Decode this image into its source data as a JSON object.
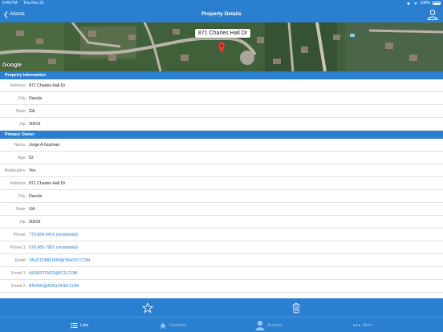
{
  "status_bar": {
    "time": "5:49 PM",
    "date": "Thu Nov 21",
    "battery": "100%"
  },
  "nav": {
    "back_label": "Atlanta",
    "title": "Property Details"
  },
  "map": {
    "callout": "871 Charles Hall Dr",
    "google_logo": "Google"
  },
  "property_info": {
    "header": "Property Information",
    "rows": [
      {
        "label": "Address:",
        "value": "871 Charles Hall Dr"
      },
      {
        "label": "City:",
        "value": "Dacula"
      },
      {
        "label": "State:",
        "value": "GA"
      },
      {
        "label": "Zip:",
        "value": "30019"
      }
    ]
  },
  "primary_owner": {
    "header": "Primary Owner",
    "rows": [
      {
        "label": "Name:",
        "value": "Jorge A Guzman"
      },
      {
        "label": "Age:",
        "value": "52"
      },
      {
        "label": "Bankruptcy:",
        "value": "Yes"
      },
      {
        "label": "Address:",
        "value": "871 Charles Hall Dr"
      },
      {
        "label": "City:",
        "value": "Dacula"
      },
      {
        "label": "State:",
        "value": "GA"
      },
      {
        "label": "Zip:",
        "value": "30019"
      },
      {
        "label": "Phone:",
        "value": "770-564-0416 (residential)"
      },
      {
        "label": "Phone 1:",
        "value": "678-985-7952 (residential)"
      },
      {
        "label": "Email:",
        "value": "TALKTOMRJAIN@YAHOO.COM"
      },
      {
        "label": "Email 1:",
        "value": "ALBERTO423@ICS.COM"
      },
      {
        "label": "Email 2:",
        "value": "BNYAG@ADELPHIA.COM"
      }
    ]
  },
  "tabs": [
    {
      "label": "Lists",
      "icon": "list-icon",
      "active": true
    },
    {
      "label": "Favorites",
      "icon": "star-icon",
      "active": false
    },
    {
      "label": "Account",
      "icon": "person-icon",
      "active": false
    },
    {
      "label": "More",
      "icon": "ellipsis-icon",
      "active": false
    }
  ],
  "colors": {
    "accent": "#2b7fd1",
    "link": "#2b7fd1",
    "pin": "#e53935"
  }
}
